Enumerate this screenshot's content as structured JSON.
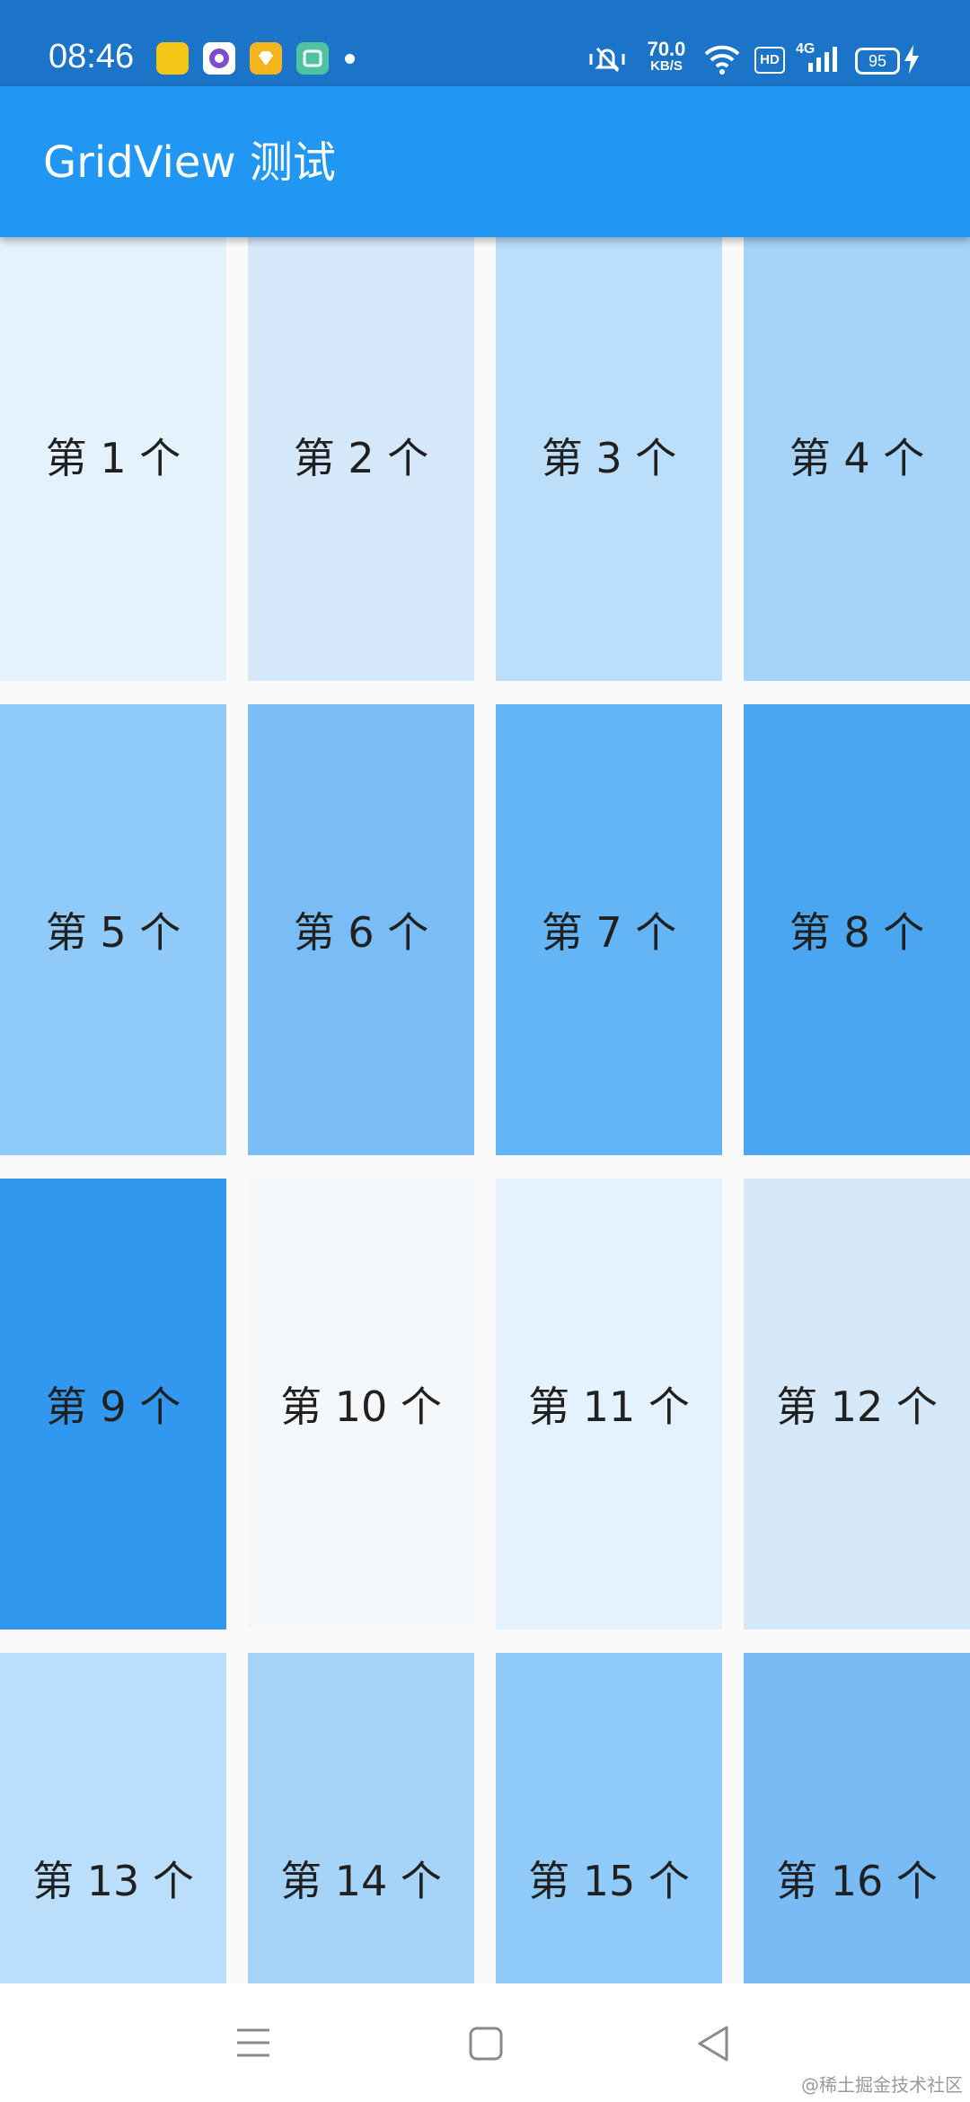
{
  "status_bar": {
    "time": "08:46",
    "notification_icons": [
      {
        "name": "yellow-app-icon",
        "color": "#f5c518"
      },
      {
        "name": "purple-app-icon",
        "color": "#7b4fc9"
      },
      {
        "name": "diamond-app-icon",
        "color": "#f2b51d"
      },
      {
        "name": "green-app-icon",
        "color": "#4fc3a1"
      }
    ],
    "net_speed_value": "70.0",
    "net_speed_unit": "KB/S",
    "network_type": "4G",
    "hd_label": "HD",
    "battery_level": "95"
  },
  "app_bar": {
    "title": "GridView 测试",
    "color": "#2196f3"
  },
  "grid": {
    "tiles": [
      {
        "label": "第 1 个",
        "color": "#e3f2fd"
      },
      {
        "label": "第 2 个",
        "color": "#d4e8f9"
      },
      {
        "label": "第 3 个",
        "color": "#bbdefb"
      },
      {
        "label": "第 4 个",
        "color": "#a6d3f8"
      },
      {
        "label": "第 5 个",
        "color": "#90caf9"
      },
      {
        "label": "第 6 个",
        "color": "#79bcf6"
      },
      {
        "label": "第 7 个",
        "color": "#64b5f6"
      },
      {
        "label": "第 8 个",
        "color": "#4aa6f0"
      },
      {
        "label": "第 9 个",
        "color": "#3298ef"
      },
      {
        "label": "第 10 个",
        "color": "#f5f8fb"
      },
      {
        "label": "第 11 个",
        "color": "#e3f2fd"
      },
      {
        "label": "第 12 个",
        "color": "#d4e8f7"
      },
      {
        "label": "第 13 个",
        "color": "#bbdefb"
      },
      {
        "label": "第 14 个",
        "color": "#a6d3f8"
      },
      {
        "label": "第 15 个",
        "color": "#90caf9"
      },
      {
        "label": "第 16 个",
        "color": "#78bbf5"
      }
    ]
  },
  "nav_bar": {
    "buttons": [
      {
        "name": "menu-icon"
      },
      {
        "name": "home-icon"
      },
      {
        "name": "back-icon"
      }
    ]
  },
  "watermark": "@稀土掘金技术社区"
}
